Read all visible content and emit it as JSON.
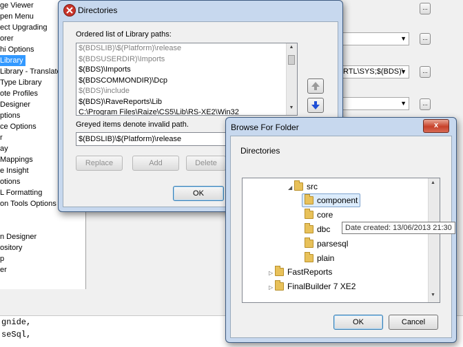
{
  "options_tree": {
    "items": [
      {
        "label": "ge Viewer",
        "selected": false
      },
      {
        "label": "pen Menu",
        "selected": false
      },
      {
        "label": "ect Upgrading",
        "selected": false
      },
      {
        "label": "orer",
        "selected": false
      },
      {
        "label": "hi Options",
        "selected": false
      },
      {
        "label": "Library",
        "selected": true
      },
      {
        "label": "Library - Translate",
        "selected": false
      },
      {
        "label": "Type Library",
        "selected": false
      },
      {
        "label": "ote Profiles",
        "selected": false
      },
      {
        "label": "Designer",
        "selected": false
      },
      {
        "label": "ptions",
        "selected": false
      },
      {
        "label": "ce Options",
        "selected": false
      },
      {
        "label": "r",
        "selected": false
      },
      {
        "label": "ay",
        "selected": false
      },
      {
        "label": "Mappings",
        "selected": false
      },
      {
        "label": "e Insight",
        "selected": false
      },
      {
        "label": "otions",
        "selected": false
      },
      {
        "label": "L Formatting",
        "selected": false
      },
      {
        "label": "on Tools Options",
        "selected": false
      },
      {
        "label": "",
        "selected": false
      },
      {
        "label": "",
        "selected": false
      },
      {
        "label": "n Designer",
        "selected": false
      },
      {
        "label": "ository",
        "selected": false
      },
      {
        "label": "p",
        "selected": false
      },
      {
        "label": "er",
        "selected": false
      }
    ]
  },
  "background": {
    "combo_path_value": "RTL\\SYS;$(BDS)\\",
    "ellipsis_label": "..."
  },
  "code_lines": [
    "gnide,",
    "seSql,"
  ],
  "directories_dialog": {
    "title": "Directories",
    "list_label": "Ordered list of Library paths:",
    "paths": [
      {
        "text": "$(BDSLIB)\\$(Platform)\\release",
        "grey": true
      },
      {
        "text": "$(BDSUSERDIR)\\Imports",
        "grey": true
      },
      {
        "text": "$(BDS)\\Imports",
        "grey": false
      },
      {
        "text": "$(BDSCOMMONDIR)\\Dcp",
        "grey": false
      },
      {
        "text": "$(BDS)\\include",
        "grey": true
      },
      {
        "text": "$(BDS)\\RaveReports\\Lib",
        "grey": false
      },
      {
        "text": "C:\\Program Files\\Raize\\CS5\\Lib\\RS-XE2\\Win32",
        "grey": false
      }
    ],
    "greyed_note": "Greyed items denote invalid path.",
    "edit_value": "$(BDSLIB)\\$(Platform)\\release",
    "replace_label": "Replace",
    "add_label": "Add",
    "delete_label": "Delete",
    "ok_label": "OK"
  },
  "browse_dialog": {
    "title": "Browse For Folder",
    "close_label": "x",
    "heading": "Directories",
    "nodes": [
      {
        "label": "src",
        "expanded": true
      },
      {
        "label": "component",
        "selected": true
      },
      {
        "label": "core"
      },
      {
        "label": "dbc"
      },
      {
        "label": "parsesql"
      },
      {
        "label": "plain"
      },
      {
        "label": "FastReports",
        "expanded": false
      },
      {
        "label": "FinalBuilder 7 XE2",
        "expanded": false
      }
    ],
    "tooltip": "Date created: 13/06/2013 21:30",
    "ok_label": "OK",
    "cancel_label": "Cancel"
  }
}
